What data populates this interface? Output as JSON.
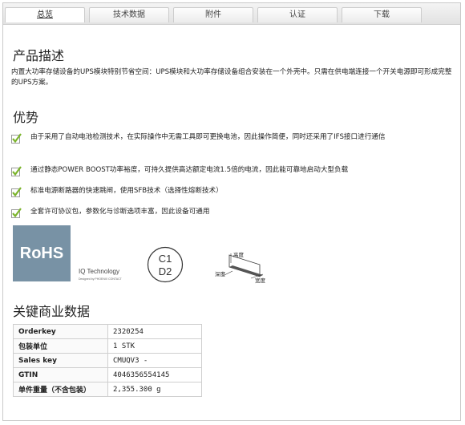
{
  "tabs": [
    {
      "label": "总览",
      "active": true
    },
    {
      "label": "技术数据",
      "active": false
    },
    {
      "label": "附件",
      "active": false
    },
    {
      "label": "认证",
      "active": false
    },
    {
      "label": "下载",
      "active": false
    }
  ],
  "description": {
    "title": "产品描述",
    "text": "内置大功率存储设备的UPS模块特别节省空间：UPS模块和大功率存储设备组合安装在一个外壳中。只需在供电端连接一个开关电源即可形成完整的UPS方案。"
  },
  "advantages": {
    "title": "优势",
    "items": [
      "由于采用了自动电池检测技术，在实际操作中无需工具即可更换电池，因此操作简便，同时还采用了IFS接口进行通信",
      "通过静态POWER BOOST功率裕度，可持久提供高达额定电流1.5倍的电流，因此能可靠地启动大型负载",
      "标准电源断路器的快速跳闸，使用SFB技术（选择性熔断技术）",
      "全套许可协议包，参数化与诊断选项丰富，因此设备可通用"
    ]
  },
  "logos": {
    "rohs": "RoHS",
    "iq_line1": "IQ Technology",
    "iq_line2": "Designed by PHOENIX CONTACT",
    "c1": "C1",
    "d2": "D2",
    "dim_height": "高度",
    "dim_depth": "深度",
    "dim_width": "宽度"
  },
  "business": {
    "title": "关键商业数据",
    "rows": [
      {
        "key": "Orderkey",
        "value": "2320254"
      },
      {
        "key": "包装单位",
        "value": "1 STK"
      },
      {
        "key": "Sales key",
        "value": "CMUQV3 -"
      },
      {
        "key": "GTIN",
        "value": "4046356554145"
      },
      {
        "key": "单件重量（不含包装）",
        "value": "2,355.300 g"
      }
    ]
  },
  "colors": {
    "check": "#7bb42c",
    "rohs": "#7892a5"
  }
}
